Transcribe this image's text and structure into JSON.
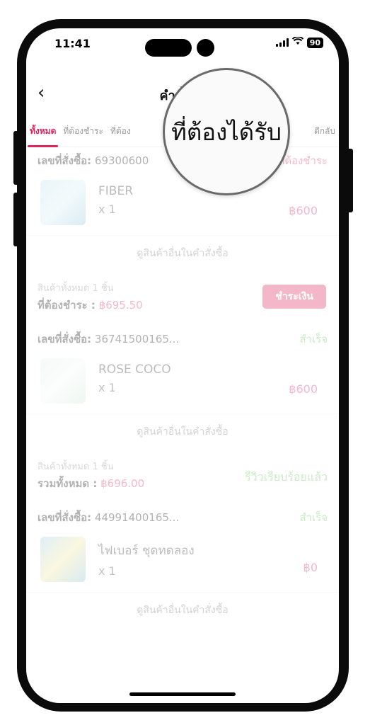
{
  "status_bar": {
    "time": "11:41",
    "battery": "90",
    "signal_icon": "signal-icon",
    "wifi_icon": "wifi-icon"
  },
  "navbar": {
    "back_icon": "chevron-left-icon",
    "back_glyph": "‹",
    "title": "คำสั่งซื้อ"
  },
  "tabs": [
    {
      "label": "ทั้งหมด",
      "active": true
    },
    {
      "label": "ที่ต้องชำระ"
    },
    {
      "label": "ที่ต้อง"
    },
    {
      "label": "ตีกลับ"
    }
  ],
  "magnifier": {
    "text": "ที่ต้องได้รับ"
  },
  "orders": [
    {
      "order_label": "เลขที่สั่งซื้อ:",
      "order_number": "69300600",
      "status": "ที่ต้องชำระ",
      "product_name": "FIBER",
      "quantity": "x 1",
      "price": "฿600",
      "more_link": "ดูสินค้าอื่นในคำสั่งซื้อ",
      "summary_count": "สินค้าทั้งหมด 1 ชิ้น",
      "summary_label": "ที่ต้องชำระ :",
      "summary_amount": "฿695.50",
      "action": "ชำระเงิน"
    },
    {
      "order_label": "เลขที่สั่งซื้อ:",
      "order_number": "36741500165...",
      "status": "สำเร็จ",
      "product_name": "ROSE COCO",
      "quantity": "x 1",
      "price": "฿600",
      "more_link": "ดูสินค้าอื่นในคำสั่งซื้อ",
      "summary_count": "สินค้าทั้งหมด 1 ชิ้น",
      "summary_label": "รวมทั้งหมด :",
      "summary_amount": "฿696.00",
      "action": "รีวิวเรียบร้อยแล้ว"
    },
    {
      "order_label": "เลขที่สั่งซื้อ:",
      "order_number": "44991400165...",
      "status": "สำเร็จ",
      "product_name": "ไฟเบอร์ ชุดทดลอง",
      "quantity": "x 1",
      "price": "฿0",
      "more_link": "ดูสินค้าอื่นในคำสั่งซื้อ"
    }
  ]
}
